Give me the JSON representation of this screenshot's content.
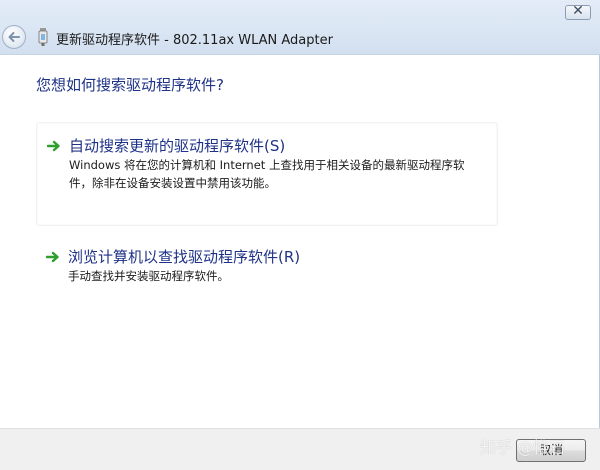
{
  "window": {
    "title": "更新驱动程序软件 - 802.11ax WLAN Adapter",
    "close_label": "✕"
  },
  "main": {
    "heading": "您想如何搜索驱动程序软件?",
    "options": [
      {
        "title": "自动搜索更新的驱动程序软件(S)",
        "description_lines": [
          "Windows 将在您的计算机和 Internet 上查找用于相关设备的最新驱动程序软",
          "件，除非在设备安装设置中禁用该功能。"
        ]
      },
      {
        "title": "浏览计算机以查找驱动程序软件(R)",
        "description_lines": [
          "手动查找并安装驱动程序软件。"
        ]
      }
    ]
  },
  "footer": {
    "cancel_label": "取消"
  },
  "watermark": "知乎 @惟石",
  "icons": {
    "back": "back-arrow-icon",
    "adapter": "network-adapter-icon",
    "option_arrow": "green-arrow-icon"
  },
  "colors": {
    "heading": "#1e3287",
    "arrow": "#2e9e2e",
    "header_bg": "#dbe6f4",
    "footer_bg": "#f0f0f0"
  }
}
